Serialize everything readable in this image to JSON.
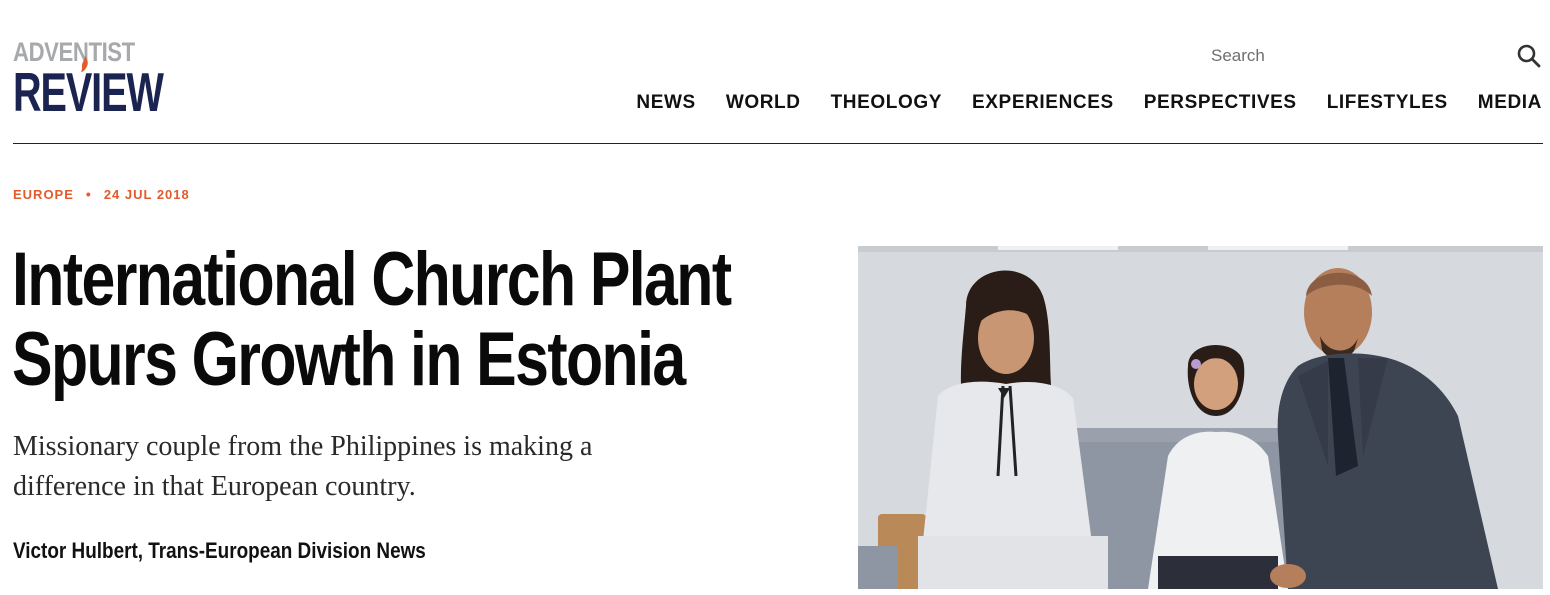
{
  "header": {
    "logo_top": "ADVENTIST",
    "logo_bottom": "REVIEW",
    "search_placeholder": "Search",
    "nav": [
      "NEWS",
      "WORLD",
      "THEOLOGY",
      "EXPERIENCES",
      "PERSPECTIVES",
      "LIFESTYLES",
      "MEDIA"
    ]
  },
  "article": {
    "category": "EUROPE",
    "date": "24 JUL 2018",
    "title_line1": "International Church Plant",
    "title_line2": "Spurs Growth in Estonia",
    "dek_line1": "Missionary couple from the Philippines is making a",
    "dek_line2": "difference in that European country.",
    "byline": "Victor Hulbert, Trans-European Division News"
  },
  "colors": {
    "accent": "#e35a2b",
    "logo_navy": "#1b2350",
    "logo_gray": "#a7a9ac"
  },
  "icons": {
    "search": "search-icon",
    "logo_flame": "flame-icon"
  }
}
